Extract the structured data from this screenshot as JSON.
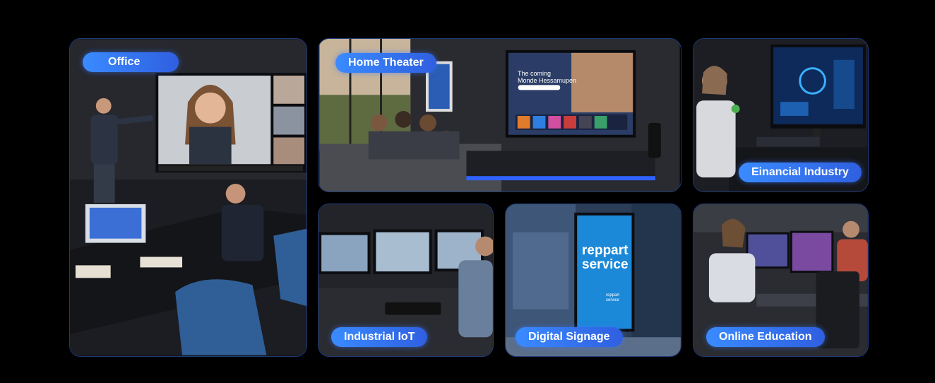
{
  "tiles": {
    "office": {
      "label": "Office"
    },
    "home_theater": {
      "label": "Home Theater",
      "tv_headline_1": "The coming",
      "tv_headline_2": "Monde Hessamupen"
    },
    "financial": {
      "label": "Einancial Industry"
    },
    "iot": {
      "label": "Industrial IoT"
    },
    "signage": {
      "label": "Digital Signage",
      "screen_text": "reppart service",
      "screen_small": "reppart service"
    },
    "education": {
      "label": "Online Education"
    }
  },
  "colors": {
    "accent": "#3a8bff",
    "border": "#1f3a78",
    "background": "#000000"
  }
}
